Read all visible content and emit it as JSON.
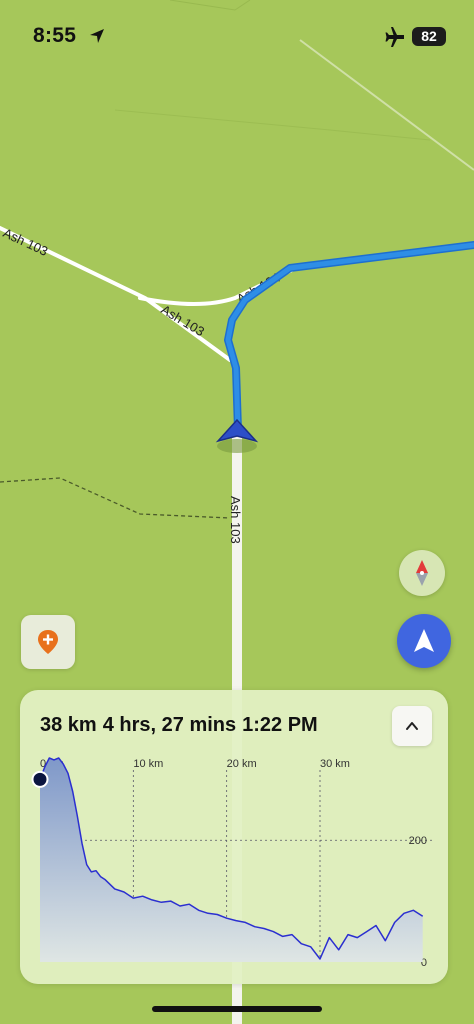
{
  "status_bar": {
    "time": "8:55",
    "battery": "82",
    "icons": [
      "location-arrow-icon",
      "airplane-icon",
      "battery-icon"
    ]
  },
  "map": {
    "road_labels": [
      "Ash 103",
      "Ash 103",
      "Ash 104",
      "Ash 103"
    ],
    "route_color": "#2e8ee6",
    "position_marker_color": "#2d4fc8"
  },
  "buttons": {
    "compass": "compass-icon",
    "locate": "navigation-arrow-icon",
    "add_poi": "add-place-icon",
    "collapse": "chevron-up-icon"
  },
  "route_summary": {
    "distance": "38 km",
    "duration": "4 hrs, 27 mins",
    "arrival": "1:22 PM"
  },
  "chart_data": {
    "type": "area",
    "title": "",
    "x_tick_labels": [
      "0 km",
      "10 km",
      "20 km",
      "30 km"
    ],
    "x_ticks": [
      0,
      10,
      20,
      30
    ],
    "y_tick_labels": [
      "200",
      "0"
    ],
    "y_ticks": [
      200,
      0
    ],
    "xlim": [
      0,
      42
    ],
    "ylim": [
      0,
      340
    ],
    "grid": true,
    "current_position_km": 0,
    "series": [
      {
        "x": [
          0,
          0.5,
          1,
          1.5,
          2,
          2.5,
          3,
          3.5,
          4,
          4.5,
          5,
          5.5,
          6,
          6.5,
          7,
          8,
          9,
          10,
          11,
          12,
          13,
          14,
          15,
          16,
          17,
          18,
          19,
          20,
          21,
          22,
          23,
          24,
          25,
          26,
          27,
          28,
          29,
          30,
          31,
          32,
          33,
          34,
          35,
          36,
          37,
          38,
          39,
          40,
          41
        ],
        "values": [
          300,
          320,
          335,
          332,
          335,
          325,
          310,
          280,
          240,
          195,
          160,
          148,
          150,
          140,
          135,
          120,
          115,
          105,
          108,
          102,
          98,
          100,
          92,
          95,
          85,
          80,
          78,
          72,
          68,
          65,
          58,
          55,
          50,
          42,
          45,
          30,
          25,
          5,
          40,
          20,
          45,
          40,
          50,
          60,
          35,
          65,
          80,
          85,
          75
        ]
      }
    ],
    "colors": {
      "line": "#2b2fd0",
      "fill_top": "#7f98c9",
      "fill_bottom": "#dfe6e4",
      "marker": "#0b1540"
    }
  }
}
